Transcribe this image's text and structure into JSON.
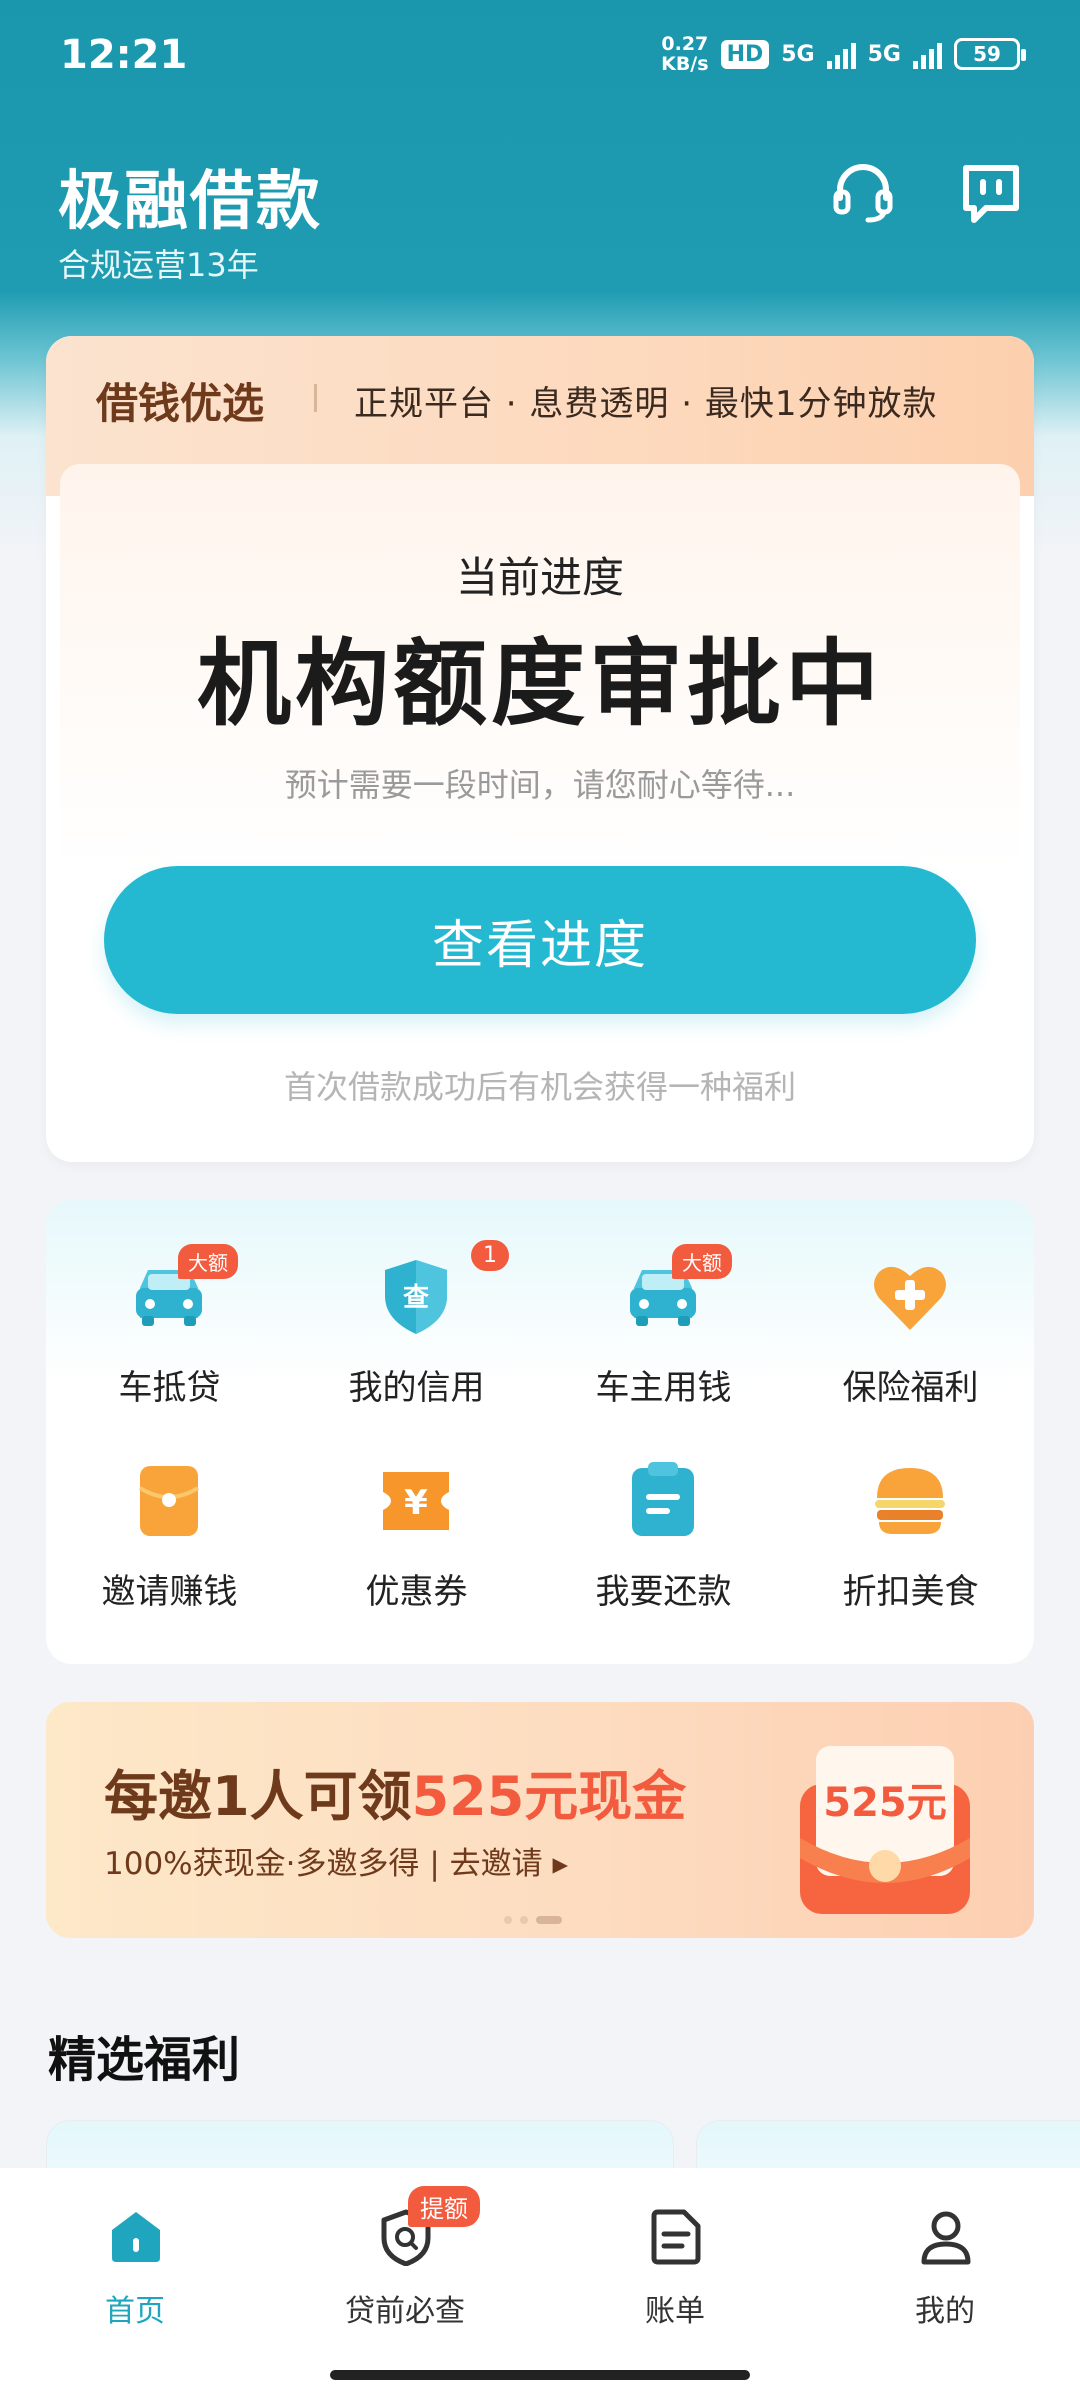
{
  "status_bar": {
    "time": "12:21",
    "speed_value": "0.27",
    "speed_unit": "KB/s",
    "hd_label": "HD",
    "net1": "5G",
    "net2": "5G",
    "battery": "59"
  },
  "header": {
    "title": "极融借款",
    "subtitle": "合规运营13年",
    "support_icon": "headset-icon",
    "message_icon": "message-icon"
  },
  "promo_strip": {
    "brand": "借钱优选",
    "features": "正规平台 · 息费透明 · 最快1分钟放款"
  },
  "progress_card": {
    "label": "当前进度",
    "status": "机构额度审批中",
    "hint": "预计需要一段时间，请您耐心等待...",
    "button": "查看进度",
    "benefit_hint": "首次借款成功后有机会获得一种福利"
  },
  "services": [
    {
      "label": "车抵贷",
      "icon": "car-icon",
      "badge": "大额"
    },
    {
      "label": "我的信用",
      "icon": "credit-shield-icon",
      "badge": "1"
    },
    {
      "label": "车主用钱",
      "icon": "car-icon",
      "badge": "大额"
    },
    {
      "label": "保险福利",
      "icon": "heart-plus-icon",
      "badge": ""
    },
    {
      "label": "邀请赚钱",
      "icon": "envelope-icon",
      "badge": ""
    },
    {
      "label": "优惠券",
      "icon": "coupon-icon",
      "badge": ""
    },
    {
      "label": "我要还款",
      "icon": "clipboard-icon",
      "badge": ""
    },
    {
      "label": "折扣美食",
      "icon": "burger-icon",
      "badge": ""
    }
  ],
  "banner": {
    "title_prefix": "每邀1人可领",
    "title_highlight": "525元现金",
    "subtitle": "100%获现金·多邀多得 | 去邀请 ▸",
    "envelope_text": "525元"
  },
  "section": {
    "title": "精选福利"
  },
  "tabbar": {
    "items": [
      {
        "label": "首页",
        "icon": "home-icon",
        "active": true
      },
      {
        "label": "贷前必查",
        "icon": "search-shield-icon",
        "active": false
      },
      {
        "label": "账单",
        "icon": "bill-icon",
        "active": false
      },
      {
        "label": "我的",
        "icon": "user-icon",
        "active": false
      }
    ],
    "badge": "提额"
  },
  "colors": {
    "primary": "#25b8d1",
    "header_bg": "#1b97ad",
    "accent": "#f35b3f",
    "brown": "#6e3a1b"
  }
}
